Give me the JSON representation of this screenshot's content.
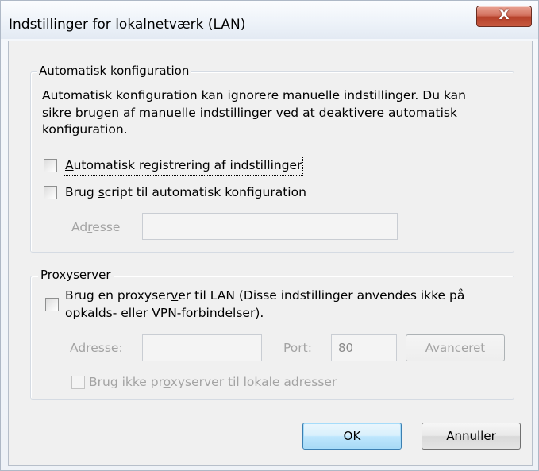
{
  "window": {
    "title": "Indstillinger for lokalnetværk (LAN)",
    "close_label": "X"
  },
  "auto_config": {
    "legend": "Automatisk konfiguration",
    "description_lines": [
      "Automatisk konfiguration kan ignorere manuelle indstillinger. Du kan",
      "sikre brugen af manuelle indstillinger ved at deaktivere automatisk",
      "konfiguration."
    ],
    "auto_detect": {
      "label_prefix": "",
      "underline": "A",
      "label_rest": "utomatisk registrering af indstillinger",
      "checked": false
    },
    "use_script": {
      "label_prefix": "Brug ",
      "underline": "s",
      "label_rest": "cript til automatisk konfiguration",
      "checked": false
    },
    "address": {
      "label_prefix": "Ad",
      "underline": "r",
      "label_rest": "esse",
      "value": ""
    }
  },
  "proxy": {
    "legend": "Proxyserver",
    "use_proxy": {
      "line1_prefix": "Brug en proxyser",
      "underline": "v",
      "line1_rest": "er til LAN (Disse indstillinger anvendes ikke på",
      "line2": "opkalds- eller VPN-forbindelser).",
      "checked": false
    },
    "address": {
      "label_underline": "A",
      "label_rest": "dresse:",
      "value": ""
    },
    "port": {
      "label_underline": "P",
      "label_rest": "ort:",
      "value": "80"
    },
    "advanced": {
      "prefix": "Avan",
      "underline": "c",
      "rest": "eret"
    },
    "bypass": {
      "prefix": "Brug ikke pr",
      "underline": "o",
      "rest": "xyserver til lokale adresser",
      "checked": false
    }
  },
  "buttons": {
    "ok": "OK",
    "cancel": "Annuller"
  }
}
